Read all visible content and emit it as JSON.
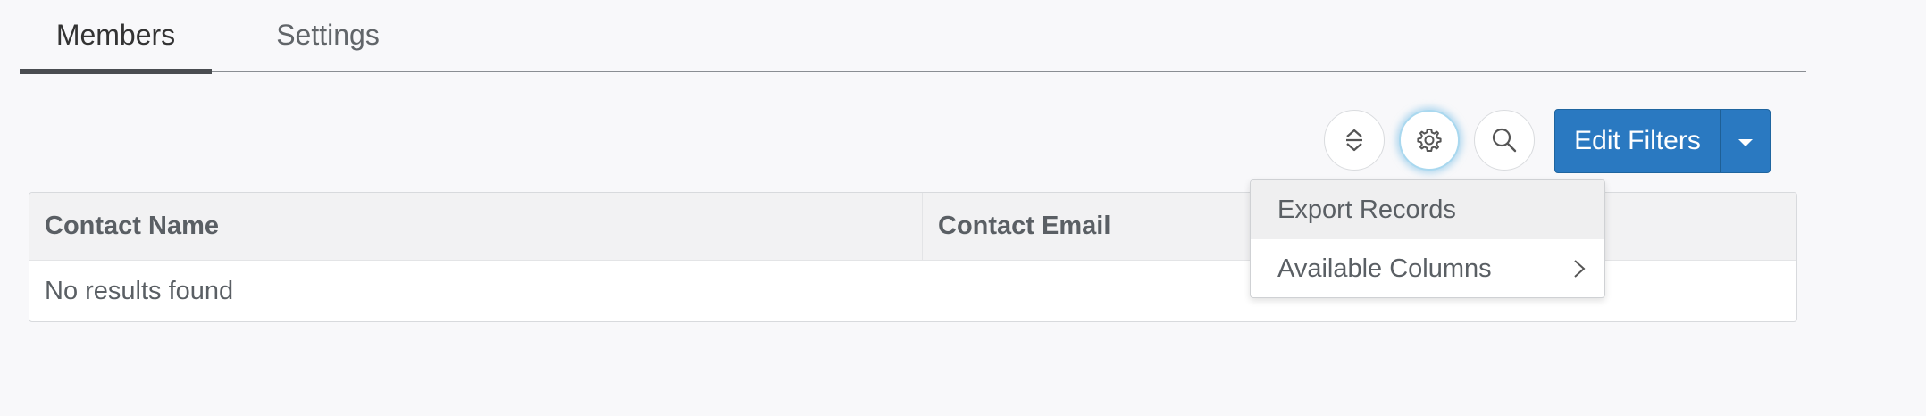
{
  "tabs": [
    {
      "label": "Members",
      "active": true
    },
    {
      "label": "Settings",
      "active": false
    }
  ],
  "toolbar": {
    "sort_icon": "sort-icon",
    "settings_icon": "gear-icon",
    "search_icon": "search-icon",
    "edit_filters_label": "Edit Filters",
    "edit_filters_caret_icon": "caret-down-icon",
    "accent_color": "#2a79c1"
  },
  "table": {
    "columns": [
      "Contact Name",
      "Contact Email"
    ],
    "empty_message": "No results found"
  },
  "menu": {
    "items": [
      {
        "label": "Export Records",
        "highlighted": true
      },
      {
        "label": "Available Columns",
        "has_submenu": true,
        "icon": "chevron-right-icon"
      }
    ]
  }
}
